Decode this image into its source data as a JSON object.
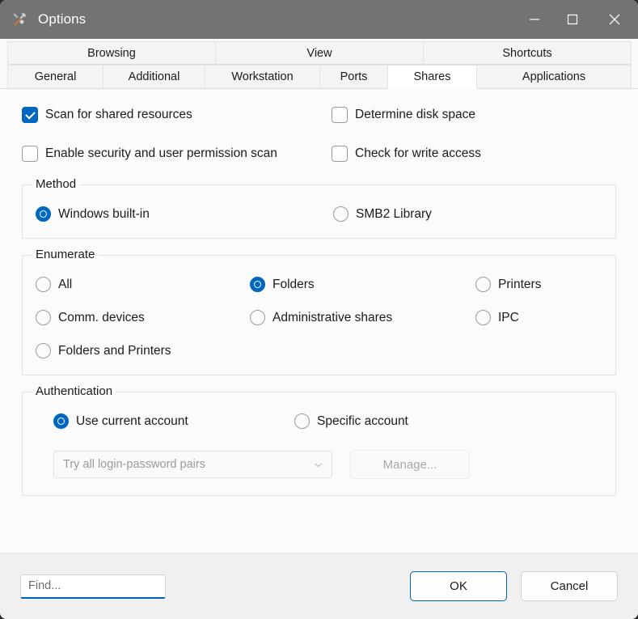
{
  "window": {
    "title": "Options",
    "icon": "tools-icon",
    "controls": {
      "minimize": "minimize-icon",
      "maximize": "maximize-icon",
      "close": "close-icon"
    },
    "colors": {
      "titlebar": "#737373",
      "accent": "#0067c0",
      "body": "#fbfbfb",
      "footer": "#f0f0f0"
    }
  },
  "tabs": {
    "row1": [
      {
        "label": "Browsing",
        "selected": false
      },
      {
        "label": "View",
        "selected": false
      },
      {
        "label": "Shortcuts",
        "selected": false
      }
    ],
    "row2": [
      {
        "label": "General",
        "selected": false
      },
      {
        "label": "Additional",
        "selected": false
      },
      {
        "label": "Workstation",
        "selected": false
      },
      {
        "label": "Ports",
        "selected": false
      },
      {
        "label": "Shares",
        "selected": true
      },
      {
        "label": "Applications",
        "selected": false
      }
    ]
  },
  "checkboxes": [
    {
      "label": "Scan for shared resources",
      "checked": true
    },
    {
      "label": "Determine disk space",
      "checked": false
    },
    {
      "label": "Enable security and user permission scan",
      "checked": false
    },
    {
      "label": "Check for write access",
      "checked": false
    }
  ],
  "method": {
    "title": "Method",
    "options": [
      {
        "label": "Windows built-in",
        "selected": true
      },
      {
        "label": "SMB2 Library",
        "selected": false
      }
    ]
  },
  "enumerate": {
    "title": "Enumerate",
    "options": [
      {
        "label": "All",
        "selected": false
      },
      {
        "label": "Folders",
        "selected": true
      },
      {
        "label": "Printers",
        "selected": false
      },
      {
        "label": "Comm. devices",
        "selected": false
      },
      {
        "label": "Administrative shares",
        "selected": false
      },
      {
        "label": "IPC",
        "selected": false
      },
      {
        "label": "Folders and Printers",
        "selected": false
      }
    ]
  },
  "authentication": {
    "title": "Authentication",
    "options": [
      {
        "label": "Use current account",
        "selected": true
      },
      {
        "label": "Specific account",
        "selected": false
      }
    ],
    "credentials_select": {
      "value": "Try all login-password pairs",
      "enabled": false,
      "icon": "chevron-down-icon"
    },
    "manage_button": {
      "label": "Manage...",
      "enabled": false
    }
  },
  "footer": {
    "find_placeholder": "Find...",
    "find_value": "",
    "ok_label": "OK",
    "cancel_label": "Cancel"
  }
}
